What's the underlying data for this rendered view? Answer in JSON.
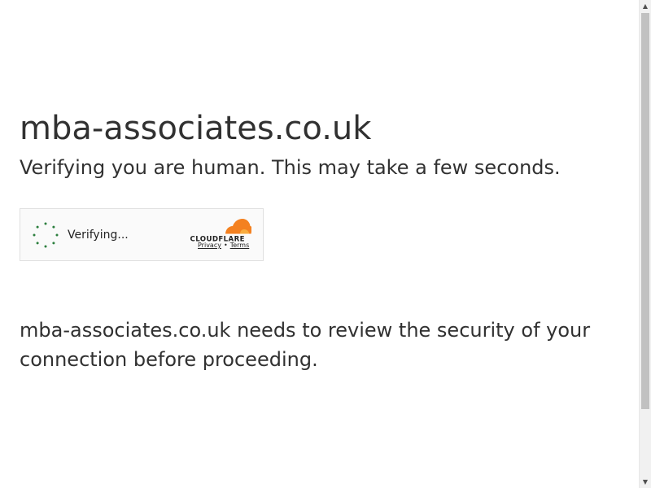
{
  "page": {
    "site_title": "mba-associates.co.uk",
    "subtitle": "Verifying you are human. This may take a few seconds.",
    "message": "mba-associates.co.uk needs to review the security of your connection before proceeding."
  },
  "widget": {
    "status_text": "Verifying...",
    "spinner_icon": "loading-spinner-icon",
    "spinner_color": "#2c7f3e",
    "logo_icon": "cloudflare-logo",
    "logo_text": "CLOUDFLARE",
    "logo_color": "#f48120",
    "privacy_label": "Privacy",
    "separator": "•",
    "terms_label": "Terms"
  },
  "scrollbar": {
    "up_icon": "▲",
    "down_icon": "▼"
  }
}
